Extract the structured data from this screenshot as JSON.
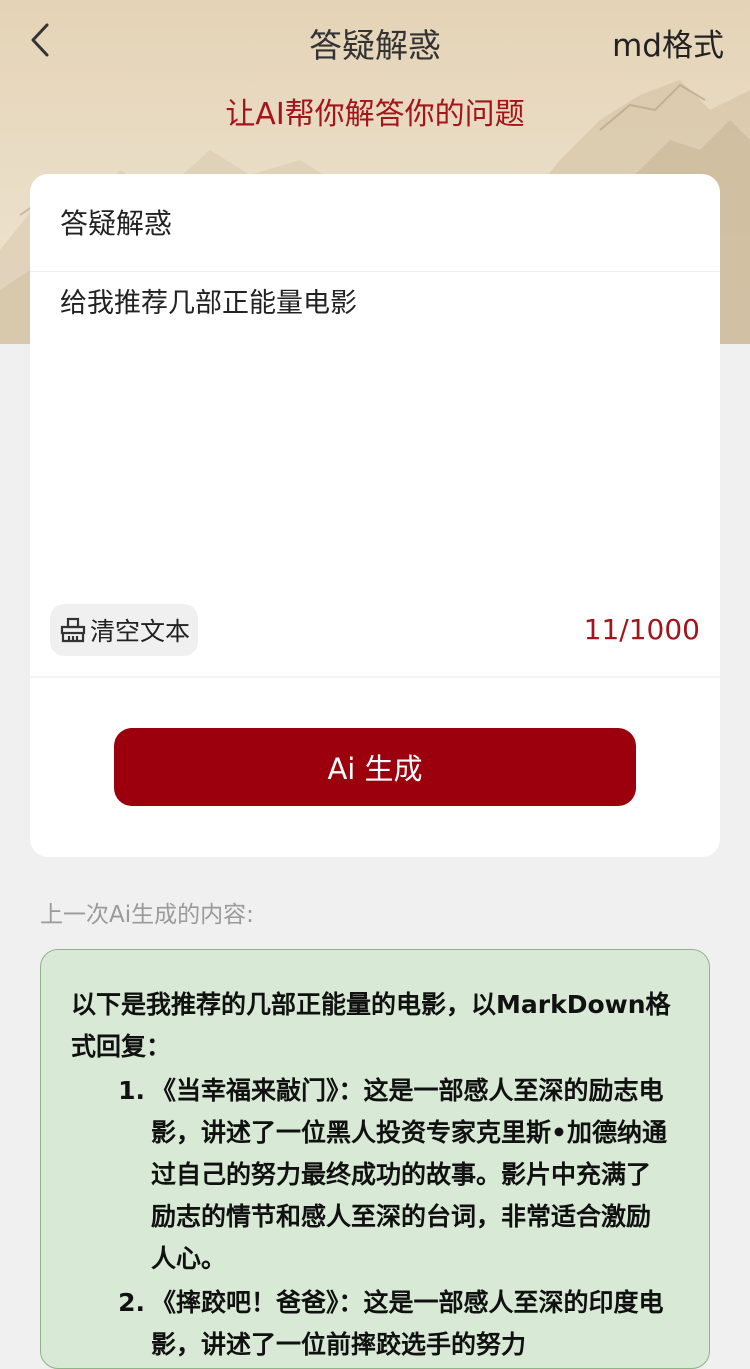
{
  "nav": {
    "back_icon": "chevron-left-icon",
    "title": "答疑解惑",
    "right_action": "md格式"
  },
  "header": {
    "subtitle": "让AI帮你解答你的问题"
  },
  "card": {
    "title": "答疑解惑",
    "prompt_value": "给我推荐几部正能量电影",
    "clear_icon": "broom-icon",
    "clear_label": "清空文本",
    "counter": "11/1000",
    "generate_label": "Ai 生成"
  },
  "last": {
    "label": "上一次Ai生成的内容:",
    "intro": "以下是我推荐的几部正能量的电影，以MarkDown格式回复：",
    "items": [
      {
        "num": "1.",
        "text": "《当幸福来敲门》：这是一部感人至深的励志电影，讲述了一位黑人投资专家克里斯•加德纳通过自己的努力最终成功的故事。影片中充满了励志的情节和感人至深的台词，非常适合激励人心。"
      },
      {
        "num": "2.",
        "text": "《摔跤吧！爸爸》：这是一部感人至深的印度电影，讲述了一位前摔跤选手的努力"
      }
    ]
  },
  "colors": {
    "accent": "#9b000c",
    "accent_text": "#a3141b",
    "result_bg": "#d8ead6",
    "result_border": "#8fb28a"
  }
}
